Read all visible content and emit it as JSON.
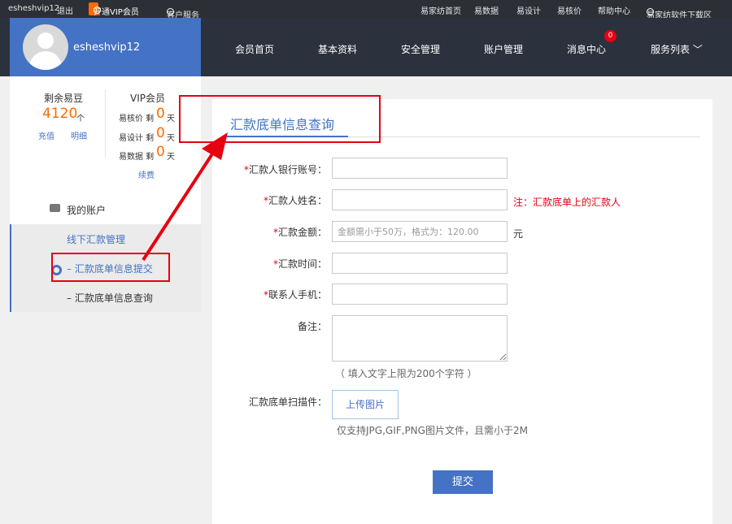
{
  "topbar": {
    "username": "esheshvip12",
    "logout": "退出",
    "vip_button": "开通VIP会员",
    "customer_service": "客户服务",
    "links": [
      "易家纺首页",
      "易数据",
      "易设计",
      "易核价",
      "帮助中心"
    ],
    "download": "易家纺软件下载区",
    "vip_color": "#ff6a00"
  },
  "profile": {
    "name": "esheshvip12",
    "bg_color": "#4472c4"
  },
  "nav": {
    "items": [
      "会员首页",
      "基本资料",
      "安全管理",
      "账户管理",
      "消息中心",
      "服务列表 ﹀"
    ],
    "message_badge": "0"
  },
  "stats": {
    "beans_label": "剩余易豆",
    "beans_value": "4120",
    "beans_unit": "个",
    "recharge": "充值",
    "detail": "明细",
    "vip_label": "VIP会员",
    "rows": [
      {
        "label": "易核价 剩",
        "value": "0",
        "unit": "天"
      },
      {
        "label": "易设计 剩",
        "value": "0",
        "unit": "天"
      },
      {
        "label": "易数据 剩",
        "value": "0",
        "unit": "天"
      }
    ],
    "renew": "续费",
    "highlight_color": "#ff6a00"
  },
  "menu": {
    "my_account": "我的账户",
    "offline_transfer": "线下汇款管理",
    "submit_item": "– 汇款底单信息提交",
    "query_item": "– 汇款底单信息查询"
  },
  "form": {
    "title": "汇款底单信息查询",
    "fields": {
      "account": {
        "label": "汇款人银行账号：",
        "value": ""
      },
      "name": {
        "label": "汇款人姓名：",
        "value": "",
        "note": "注：汇款底单上的汇款人"
      },
      "amount": {
        "label": "汇款金额：",
        "placeholder": "金额需小于50万，格式为：120.00",
        "unit": "元"
      },
      "time": {
        "label": "汇款时间：",
        "value": ""
      },
      "phone": {
        "label": "联系人手机：",
        "value": ""
      },
      "remark": {
        "label": "备注：",
        "hint": "（ 填入文字上限为200个字符 ）"
      },
      "scan": {
        "label": "汇款底单扫描件：",
        "upload": "上传图片",
        "hint": "仅支持JPG,GIF,PNG图片文件，且需小于2M"
      }
    },
    "required_mark": "*",
    "submit": "提交"
  },
  "colors": {
    "accent": "#4472c4",
    "annotation": "#e60012",
    "header_bg": "#2b313d"
  }
}
